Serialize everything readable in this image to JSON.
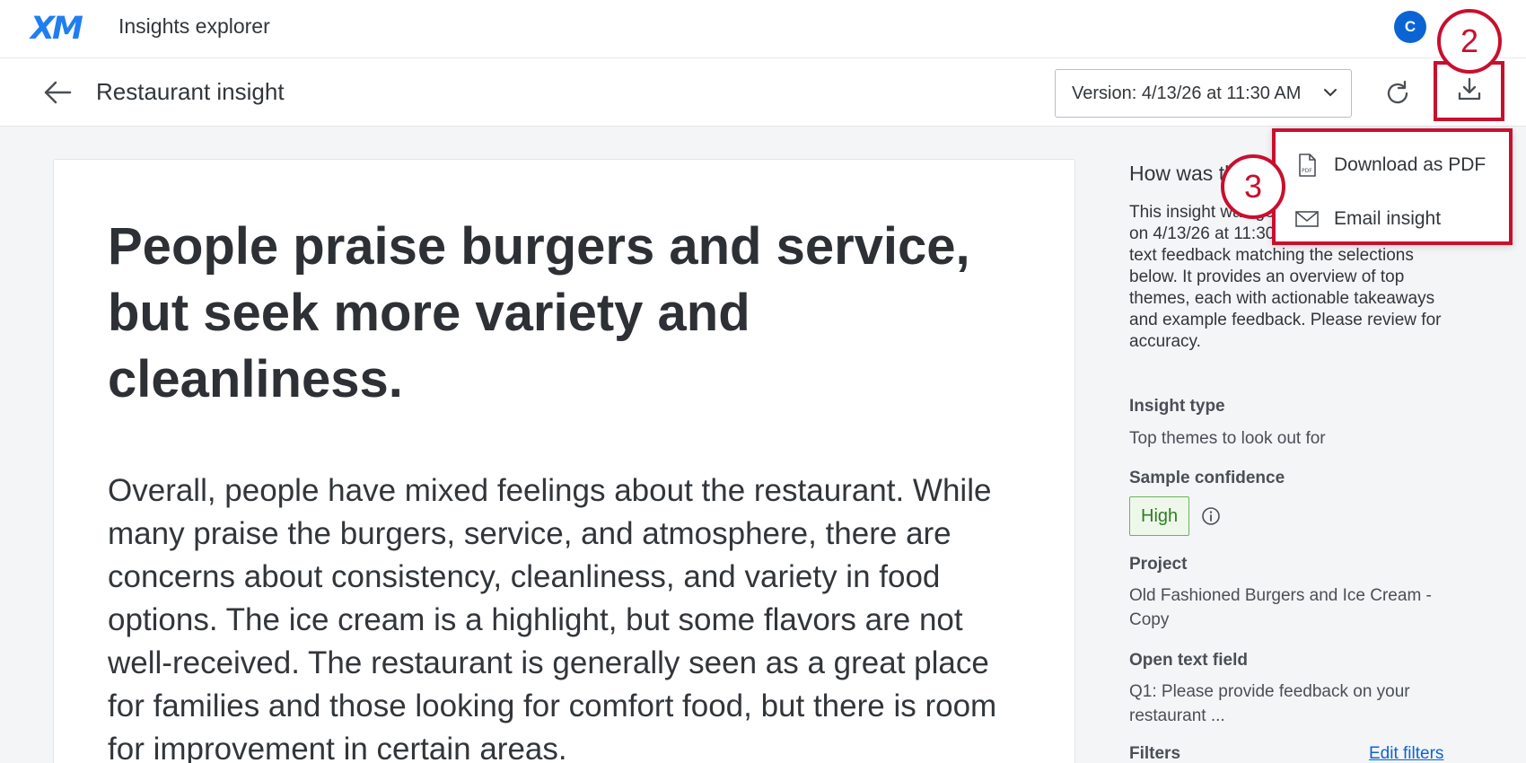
{
  "topbar": {
    "logo": "XM",
    "app_title": "Insights explorer",
    "avatar_initial": "C"
  },
  "subbar": {
    "page_title": "Restaurant insight",
    "version_label": "Version: 4/13/26 at 11:30 AM"
  },
  "callouts": {
    "download_step": "2",
    "menu_step": "3"
  },
  "download_menu": {
    "items": [
      {
        "label": "Download as PDF",
        "icon": "pdf-file-icon"
      },
      {
        "label": "Email insight",
        "icon": "envelope-icon"
      }
    ]
  },
  "main": {
    "headline": "People praise burgers and service, but seek more variety and cleanliness.",
    "summary": "Overall, people have mixed feelings about the restaurant. While many praise the burgers, service, and atmosphere, there are concerns about consistency, cleanliness, and variety in food options. The ice cream is a highlight, but some flavors are not well-received. The restaurant is generally seen as a great place for families and those looking for comfort food, but there is room for improvement in certain areas."
  },
  "sidepanel": {
    "heading": "How was this insight generated?",
    "description": "This insight was generated by Qualtrics AI on 4/13/26 at 11:30 AM based on open text feedback matching the selections below. It provides an overview of top themes, each with actionable takeaways and example feedback. Please review for accuracy.",
    "insight_type_label": "Insight type",
    "insight_type_value": "Top themes to look out for",
    "confidence_label": "Sample confidence",
    "confidence_value": "High",
    "project_label": "Project",
    "project_value": "Old Fashioned Burgers and Ice Cream - Copy",
    "open_text_label": "Open text field",
    "open_text_value": "Q1: Please provide feedback on your restaurant ...",
    "filters_label": "Filters",
    "edit_filters": "Edit filters"
  },
  "colors": {
    "accent": "#0b64d4",
    "callout": "#c8102e",
    "confidence_high": "#2e7d20"
  }
}
